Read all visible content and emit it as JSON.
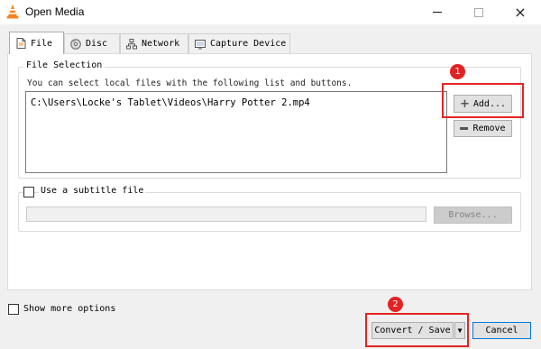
{
  "window": {
    "title": "Open Media",
    "icon": "vlc-cone-icon",
    "controls": {
      "minimize": "minimize-icon",
      "maximize": "maximize-icon",
      "close": "×"
    }
  },
  "tabs": [
    {
      "label": "File",
      "icon": "file-icon",
      "active": true
    },
    {
      "label": "Disc",
      "icon": "disc-icon",
      "active": false
    },
    {
      "label": "Network",
      "icon": "network-icon",
      "active": false
    },
    {
      "label": "Capture Device",
      "icon": "capture-device-icon",
      "active": false
    }
  ],
  "file_selection": {
    "title": "File Selection",
    "hint": "You can select local files with the following list and buttons.",
    "files": [
      "C:\\Users\\Locke's Tablet\\Videos\\Harry Potter 2.mp4"
    ],
    "add_label": "Add...",
    "remove_label": "Remove"
  },
  "subtitle": {
    "checkbox_label": "Use a subtitle file",
    "checked": false,
    "input_value": "",
    "browse_label": "Browse..."
  },
  "footer": {
    "show_more_label": "Show more options",
    "show_more_checked": false,
    "convert_label": "Convert / Save",
    "arrow": "▼",
    "cancel_label": "Cancel"
  },
  "annotations": {
    "badge_1": "1",
    "badge_2": "2",
    "color": "#e32323"
  },
  "colors": {
    "accent": "#0078d7",
    "highlight": "#e32323"
  }
}
